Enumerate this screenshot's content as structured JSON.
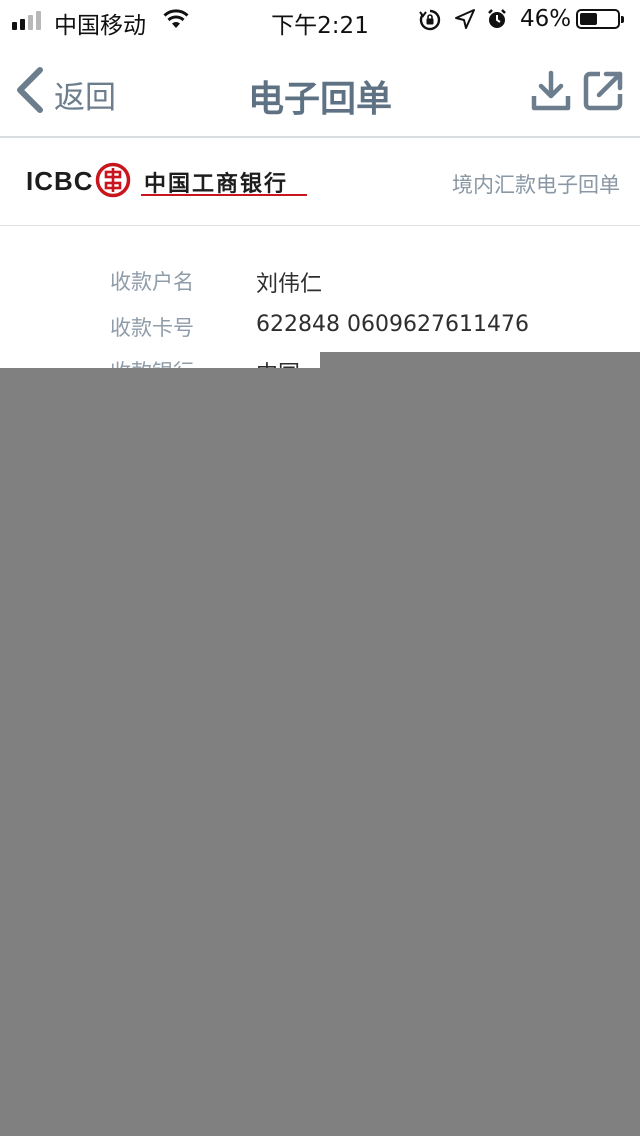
{
  "status_bar": {
    "carrier": "中国移动",
    "time": "下午2:21",
    "battery_percent": "46%",
    "battery_level": 0.46,
    "icons": [
      "signal-icon",
      "wifi-icon",
      "orientation-lock-icon",
      "location-icon",
      "alarm-icon",
      "battery-icon"
    ]
  },
  "nav": {
    "back_label": "返回",
    "title": "电子回单",
    "icons": [
      "chevron-left-icon",
      "download-icon",
      "share-icon"
    ]
  },
  "bank": {
    "abbrev": "ICBC",
    "name": "中国工商银行",
    "receipt_type": "境内汇款电子回单",
    "logo_color": "#c9151e"
  },
  "details": [
    {
      "label": "收款户名",
      "value": "刘伟仁"
    },
    {
      "label": "收款卡号",
      "value": "622848 0609627611476"
    },
    {
      "label": "收款银行",
      "value": "中国"
    }
  ],
  "colors": {
    "nav_accent": "#5e7284",
    "label_gray": "#8f9ca9",
    "redaction": "#808080"
  }
}
